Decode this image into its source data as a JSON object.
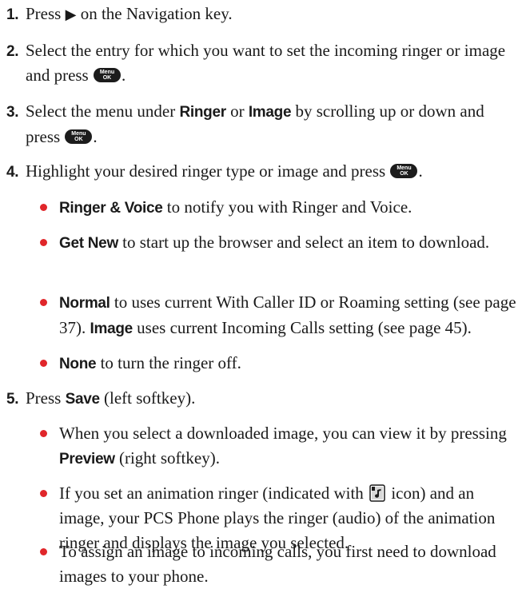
{
  "menu_key": {
    "top": "Menu",
    "bottom": "OK"
  },
  "steps": [
    {
      "number": "1.",
      "text_a": "Press ",
      "arrow": "▶",
      "text_b": " on the Navigation key."
    },
    {
      "number": "2.",
      "text_a": "Select the entry for which you want to set the incoming ringer or image and press ",
      "text_b": "."
    },
    {
      "number": "3.",
      "text_a": "Select the menu under ",
      "term_a": "Ringer",
      "text_b": " or ",
      "term_b": "Image",
      "text_c": " by scrolling up or down and press ",
      "text_d": "."
    },
    {
      "number": "4.",
      "text_a": "Highlight your desired ringer type or image and press ",
      "text_b": "."
    },
    {
      "number": "5.",
      "text_a": "Press ",
      "term_a": "Save",
      "text_b": " (left softkey)."
    }
  ],
  "options": [
    {
      "term": "Ringer & Voice",
      "text": " to notify you with Ringer and Voice."
    },
    {
      "term": "Get New",
      "text": " to start up the browser and select an item to download."
    },
    {
      "term": "Normal",
      "text": " to uses current With Caller ID or Roaming setting (see page 37). ",
      "term_b": "Image",
      "text_b": " uses current Incoming Calls setting (see page 45)."
    },
    {
      "term": "None",
      "text": " to turn the ringer off."
    }
  ],
  "notes": [
    {
      "text_a": "When you select a downloaded image, you can view it by pressing ",
      "term": "Preview",
      "text_b": " (right softkey)."
    },
    {
      "text_a": "If you set an animation ringer (indicated with ",
      "icon": "animation-ringer-icon",
      "text_b": " icon) and an image, your PCS Phone plays the ringer (audio) of the animation ringer and displays the image you selected."
    },
    {
      "text_a": "To assign an image to incoming calls, you first need to download images to your phone."
    }
  ],
  "colors": {
    "bullet": "#e0262a",
    "text": "#1a1a1a",
    "key": "#1c1c1c"
  }
}
